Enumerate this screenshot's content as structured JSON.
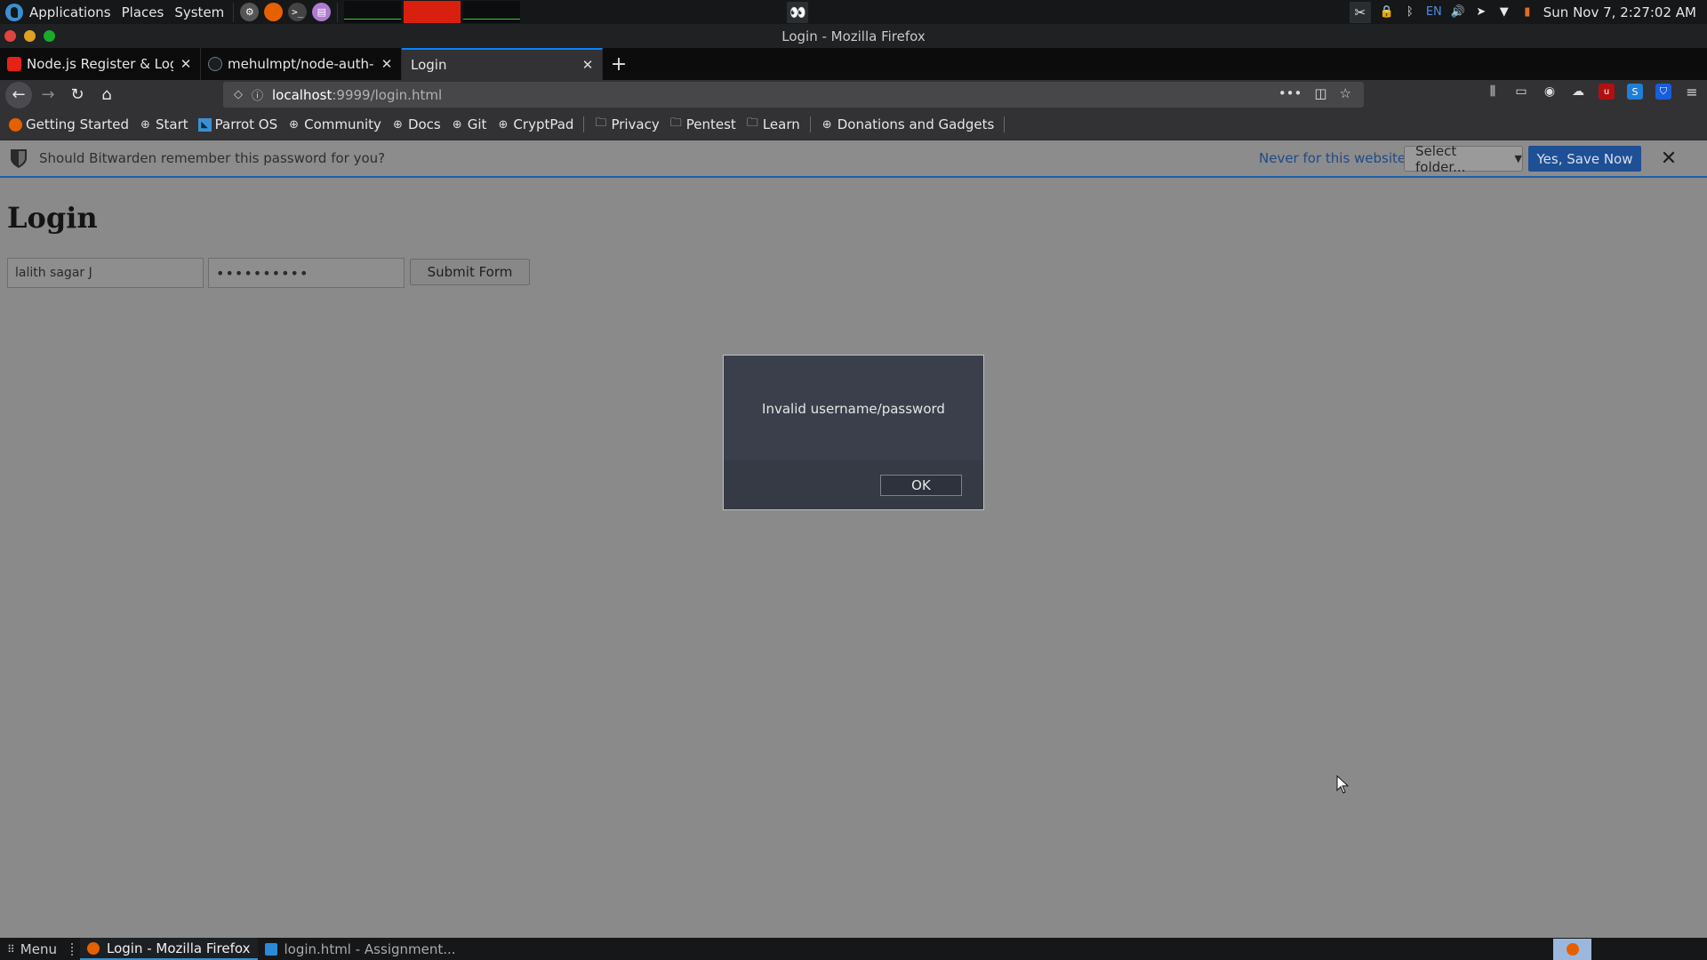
{
  "top_panel": {
    "menus": [
      "Applications",
      "Places",
      "System"
    ],
    "clock": "Sun Nov 7,  2:27:02 AM",
    "keyboard_layout": "EN"
  },
  "window": {
    "title": "Login - Mozilla Firefox"
  },
  "tabs": [
    {
      "label": "Node.js Register & Login",
      "favicon": "youtube-icon",
      "active": false
    },
    {
      "label": "mehulmpt/node-auth-yo",
      "favicon": "github-icon",
      "active": false
    },
    {
      "label": "Login",
      "favicon": "",
      "active": true
    }
  ],
  "nav": {
    "url_host": "localhost",
    "url_rest": ":9999/login.html"
  },
  "bookmarks": [
    {
      "label": "Getting Started",
      "icon": "firefox-icon"
    },
    {
      "label": "Start",
      "icon": "globe-icon"
    },
    {
      "label": "Parrot OS",
      "icon": "parrot-icon"
    },
    {
      "label": "Community",
      "icon": "globe-icon"
    },
    {
      "label": "Docs",
      "icon": "globe-icon"
    },
    {
      "label": "Git",
      "icon": "globe-icon"
    },
    {
      "label": "CryptPad",
      "icon": "globe-icon"
    },
    {
      "label": "Privacy",
      "icon": "folder-icon"
    },
    {
      "label": "Pentest",
      "icon": "folder-icon"
    },
    {
      "label": "Learn",
      "icon": "folder-icon"
    },
    {
      "label": "Donations and Gadgets",
      "icon": "globe-icon"
    }
  ],
  "bitwarden": {
    "prompt": "Should Bitwarden remember this password for you?",
    "never_label": "Never for this website",
    "folder_label": "Select folder...",
    "save_label": "Yes, Save Now"
  },
  "page": {
    "heading": "Login",
    "username_value": "lalith sagar J",
    "password_value": "••••••••••",
    "submit_label": "Submit Form"
  },
  "dialog": {
    "message": "Invalid username/password",
    "ok_label": "OK"
  },
  "taskbar": {
    "menu_label": "Menu",
    "items": [
      {
        "label": "Login - Mozilla Firefox",
        "active": true
      },
      {
        "label": "login.html - Assignment...",
        "active": false
      }
    ]
  },
  "colors": {
    "accent_blue": "#0a84ff",
    "bitwarden_save": "#1f4f94",
    "page_background": "#8a8a8a",
    "dialog_background": "#3a3f4b"
  }
}
